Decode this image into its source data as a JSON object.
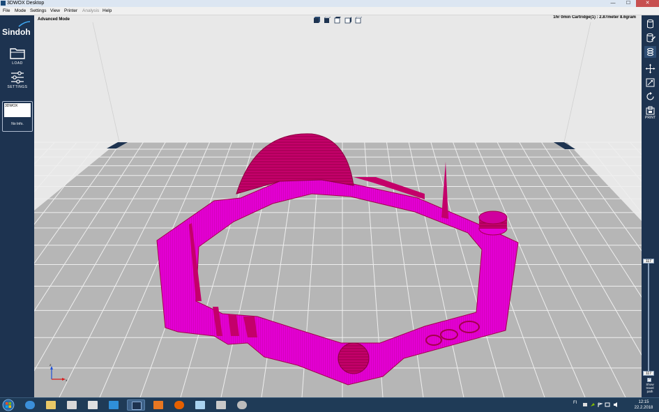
{
  "window": {
    "title": "3DWOX Desktop"
  },
  "menu": {
    "file": "File",
    "mode": "Mode",
    "settings": "Settings",
    "view": "View",
    "printer": "Printer",
    "analysis": "Analysis",
    "help": "Help"
  },
  "sidebar": {
    "brand": "Sindoh",
    "load_label": "LOAD",
    "settings_label": "SETTINGS",
    "printer_card": {
      "name": "3DWOX",
      "info": "No Info."
    }
  },
  "viewport": {
    "mode_label": "Advanced Mode",
    "status": "1hr 0min  Cartridge(1) : 2.87meter 8.6gram"
  },
  "rightbar": {
    "print_label": "PRINT"
  },
  "layer_slider": {
    "top_value": "117",
    "bottom_value": "117",
    "level": 1.0
  },
  "travel_path": {
    "label_line1": "Show",
    "label_line2": "travel",
    "label_line3": "path",
    "checked": true
  },
  "axes": {
    "x": "X",
    "z": "Z"
  },
  "taskbar": {
    "tray_text": "FI",
    "time": "12:15",
    "date": "22.2.2018"
  },
  "colors": {
    "sidebar": "#1d3350",
    "model": "#e400d4",
    "model_edge": "#a4004a",
    "bed": "#b8b8b8",
    "grid": "#f4f4f4"
  }
}
